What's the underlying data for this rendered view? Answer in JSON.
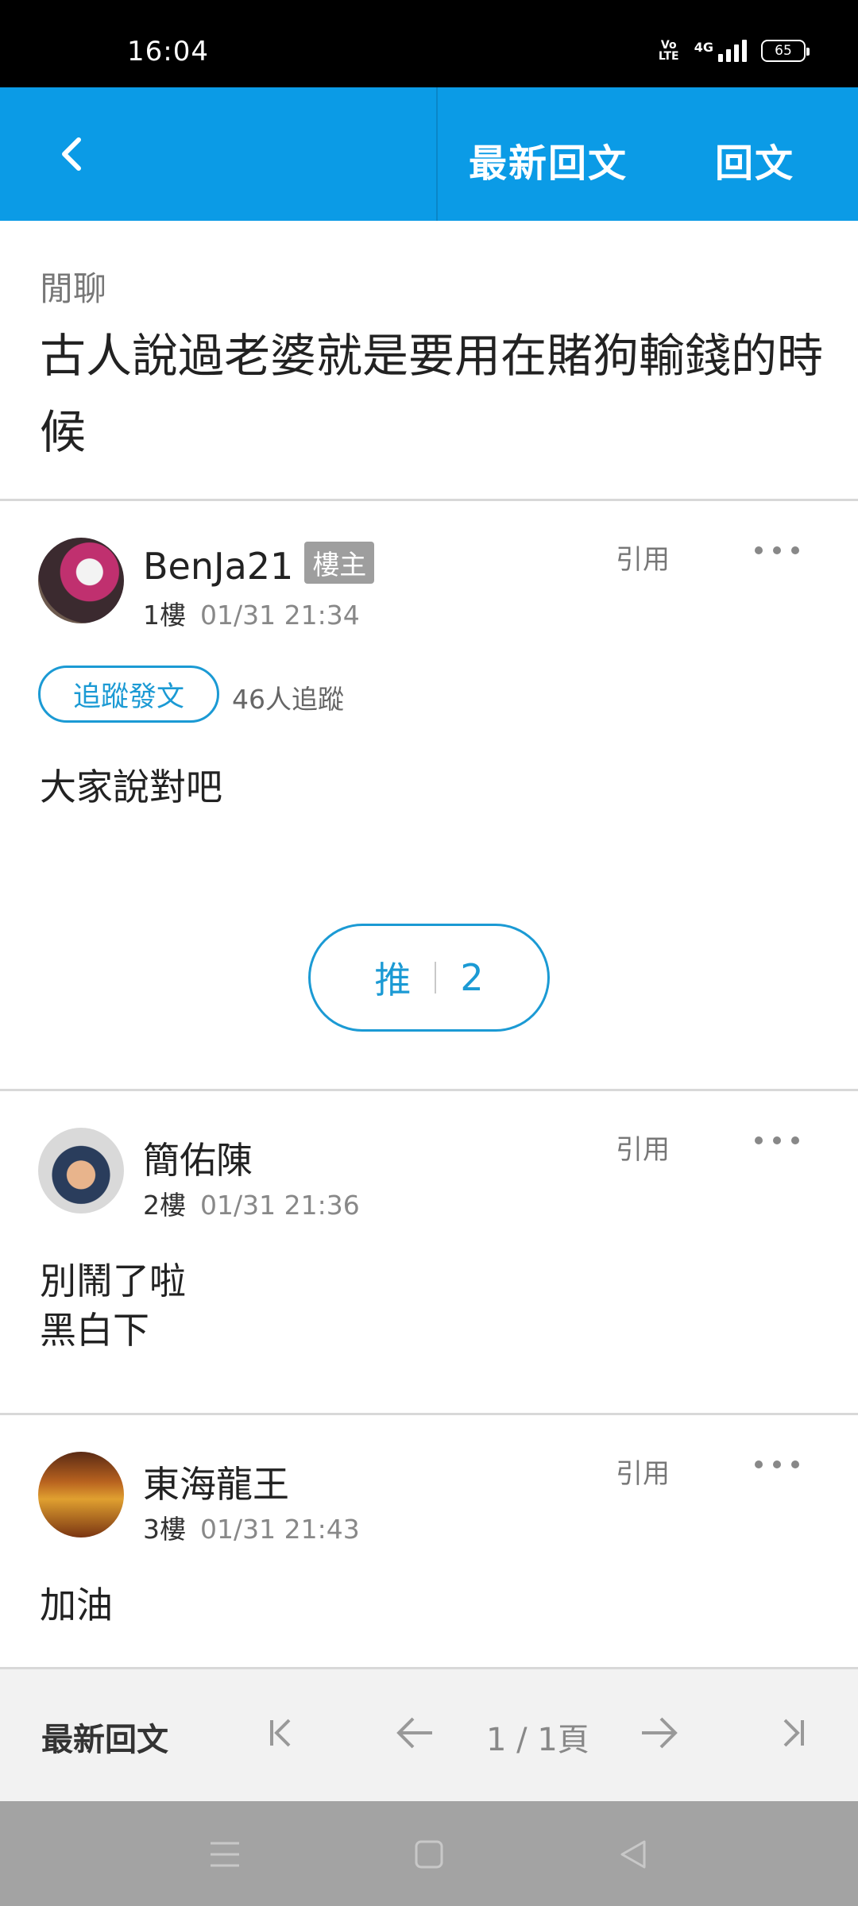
{
  "status_bar": {
    "time": "16:04",
    "volte_label": "Vo\nLTE",
    "network_label": "4G",
    "battery": "65"
  },
  "app_bar": {
    "back_icon": "chevron-left-icon",
    "latest_label": "最新回文",
    "reply_label": "回文",
    "color": "#0b9be6"
  },
  "thread": {
    "category": "閒聊",
    "title": "古人說過老婆就是要用在賭狗輸錢的時候"
  },
  "posts": [
    {
      "author": "BenJa21",
      "badge": "樓主",
      "floor": "1樓",
      "time": "01/31 21:34",
      "quote_label": "引用",
      "follow_label": "追蹤發文",
      "follow_count": "46人追蹤",
      "body": "大家說對吧",
      "push_label": "推",
      "push_count": "2"
    },
    {
      "author": "簡佑陳",
      "floor": "2樓",
      "time": "01/31 21:36",
      "quote_label": "引用",
      "body_lines": [
        "別鬧了啦",
        "黑白下"
      ]
    },
    {
      "author": "東海龍王",
      "floor": "3樓",
      "time": "01/31 21:43",
      "quote_label": "引用",
      "body": "加油"
    }
  ],
  "pager": {
    "label": "最新回文",
    "page_text": "1 / 1頁",
    "icons": [
      "first-page-icon",
      "prev-arrow-icon",
      "next-arrow-icon",
      "last-page-icon"
    ]
  },
  "nav_bar": {
    "icons": [
      "menu-icon",
      "home-icon",
      "back-triangle-icon"
    ]
  },
  "colors": {
    "accent": "#1b9ad4",
    "badge": "#9e9e9e"
  }
}
